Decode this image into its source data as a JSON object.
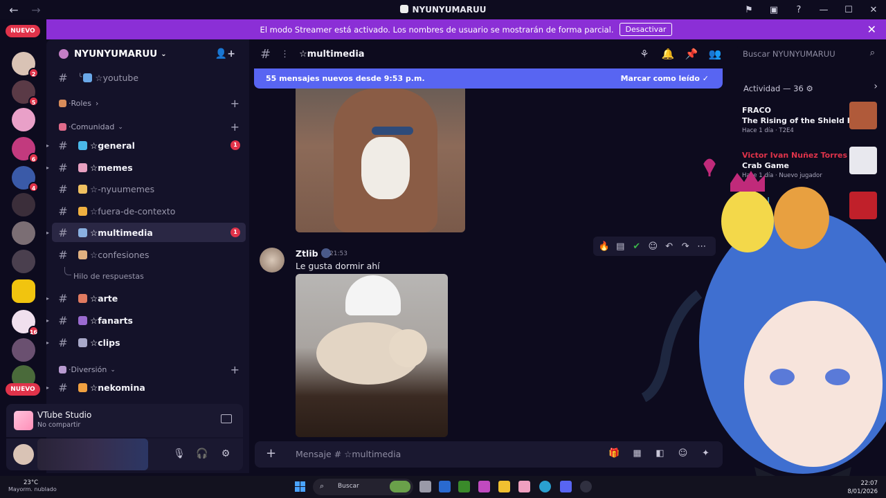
{
  "window": {
    "title": "NYUNYUMARUU"
  },
  "banner": {
    "text": "El modo Streamer está activado. Los nombres de usuario se mostrarán de forma parcial.",
    "button": "Desactivar"
  },
  "rail": {
    "new_label": "NUEVO",
    "servers": [
      {
        "badge": "2",
        "color": "#d9c3b5"
      },
      {
        "badge": "5",
        "color": "#5a3a46"
      },
      {
        "badge": "",
        "color": "#e9a0c8"
      },
      {
        "badge": "6",
        "color": "#c23a7e"
      },
      {
        "badge": "4",
        "color": "#3a5aa8"
      },
      {
        "badge": "",
        "color": "#3b2e3a"
      },
      {
        "badge": "",
        "color": "#7b6e74"
      },
      {
        "badge": "",
        "color": "#4a3f4e"
      },
      {
        "badge": "",
        "color": "#f1c40f"
      },
      {
        "badge": "16",
        "color": "#f0e0ee"
      },
      {
        "badge": "",
        "color": "#6a5070"
      },
      {
        "badge": "",
        "color": "#4a6a3a"
      }
    ]
  },
  "sidebar": {
    "server_name": "NYUNYUMARUU",
    "channels_top": [
      {
        "label": "☆youtube",
        "emoji_color": "#6aa8e8"
      }
    ],
    "categories": [
      {
        "label": "·Roles",
        "emoji_color": "#d88c5a"
      },
      {
        "label": "·Comunidad",
        "emoji_color": "#e06a8a"
      },
      {
        "label": "·Diversión",
        "emoji_color": "#b89ad0"
      }
    ],
    "channels": [
      {
        "label": "☆general",
        "emoji_color": "#4ab8e8",
        "unread": "1"
      },
      {
        "label": "☆memes",
        "emoji_color": "#e8a0c0",
        "unread": ""
      },
      {
        "label": "☆-nyuumemes",
        "emoji_color": "#f0c060",
        "unread": ""
      },
      {
        "label": "☆fuera-de-contexto",
        "emoji_color": "#f0b040",
        "unread": ""
      },
      {
        "label": "☆multimedia",
        "emoji_color": "#8ab0e0",
        "unread": "1"
      },
      {
        "label": "☆confesiones",
        "emoji_color": "#e0b080",
        "unread": ""
      },
      {
        "label": "☆arte",
        "emoji_color": "#e07a60",
        "unread": ""
      },
      {
        "label": "☆fanarts",
        "emoji_color": "#9a6ad0",
        "unread": ""
      },
      {
        "label": "☆clips",
        "emoji_color": "#a8a8c8",
        "unread": ""
      },
      {
        "label": "☆nekomina",
        "emoji_color": "#f0a040",
        "unread": ""
      }
    ],
    "thread_label": "Hilo de respuestas"
  },
  "vtube": {
    "name": "VTube Studio",
    "status": "No compartir"
  },
  "channel_header": {
    "name": "☆multimedia"
  },
  "search": {
    "placeholder": "Buscar NYUNYUMARUU"
  },
  "new_messages": {
    "text": "55 mensajes nuevos desde 9:53 p.m.",
    "action": "Marcar como leído"
  },
  "message": {
    "author": "Ztlib",
    "time": "21:53",
    "text": "Le gusta dormir ahí"
  },
  "composer": {
    "placeholder": "Mensaje # ☆multimedia"
  },
  "activity": {
    "header": "Actividad — 36",
    "items": [
      {
        "user": "FRACO",
        "user_color": "#f2f2f8",
        "title": "The Rising of the Shield Hero",
        "meta": "Hace 1 día · T2E4",
        "thumb_color": "#b05a3a"
      },
      {
        "user": "Victor Ivan Nuñez Torres",
        "user_color": "#e0334a",
        "title": "Crab Game",
        "meta": "Hace 1 día · Nuevo jugador",
        "thumb_color": "#e8e8ee"
      },
      {
        "user": "drian |",
        "user_color": "#4ab8e8",
        "title": "",
        "meta": "",
        "thumb_color": "#c0202a"
      }
    ]
  },
  "taskbar": {
    "temp": "23°C",
    "weather": "Mayorm. nublado",
    "search": "Buscar",
    "time": "22:07",
    "date": "8/01/2026"
  }
}
